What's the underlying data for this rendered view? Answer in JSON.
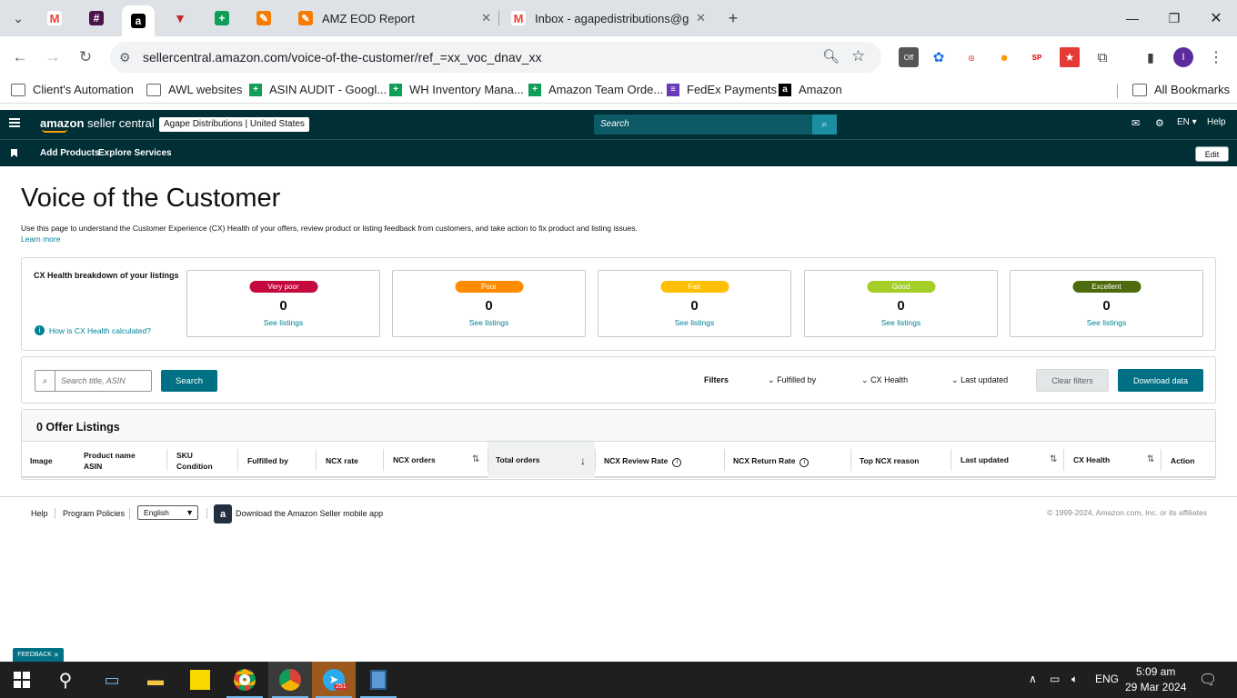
{
  "browser": {
    "tabs": [
      {
        "title": "AMZ EOD Report"
      },
      {
        "title": "Inbox - agapedistributions@gm"
      }
    ],
    "url": "sellercentral.amazon.com/voice-of-the-customer/ref_=xx_voc_dnav_xx",
    "bookmarks": [
      {
        "label": "Client's Automation"
      },
      {
        "label": "AWL websites"
      },
      {
        "label": "ASIN AUDIT - Googl..."
      },
      {
        "label": "WH Inventory Mana..."
      },
      {
        "label": "Amazon Team Orde..."
      },
      {
        "label": "FedEx Payments"
      },
      {
        "label": "Amazon"
      },
      {
        "label": "All Bookmarks"
      }
    ],
    "extension_badge": "Off"
  },
  "header": {
    "logo_brand": "amazon",
    "logo_product": "seller central",
    "account_name": "Agape Distributions",
    "account_region": "United States",
    "search_placeholder": "Search",
    "language": "EN",
    "help": "Help",
    "subnav": [
      "Add Products",
      "Explore Services"
    ],
    "edit_label": "Edit"
  },
  "page": {
    "title": "Voice of the Customer",
    "intro": "Use this page to understand the Customer Experience (CX) Health of your offers, review product or listing feedback from customers, and take action to fix product and listing issues.",
    "learn_more": "Learn more"
  },
  "cx_health": {
    "label": "CX Health breakdown of your listings",
    "how_link": "How is CX Health calculated?",
    "cards": [
      {
        "label": "Very poor",
        "count": "0",
        "link": "See listings",
        "color": "#c40a3d"
      },
      {
        "label": "Poor",
        "count": "0",
        "link": "See listings",
        "color": "#ff8c00"
      },
      {
        "label": "Fair",
        "count": "0",
        "link": "See listings",
        "color": "#ffbf00"
      },
      {
        "label": "Good",
        "count": "0",
        "link": "See listings",
        "color": "#a3cf28"
      },
      {
        "label": "Excellent",
        "count": "0",
        "link": "See listings",
        "color": "#4d6b0d"
      }
    ]
  },
  "search": {
    "placeholder": "Search title, ASIN",
    "button": "Search",
    "filters_label": "Filters",
    "filters": [
      "Fulfilled by",
      "CX Health",
      "Last updated"
    ],
    "clear_button": "Clear filters",
    "download_button": "Download data"
  },
  "table": {
    "count_label": "0 Offer Listings",
    "columns": [
      {
        "line1": "Image",
        "line2": ""
      },
      {
        "line1": "Product name",
        "line2": "ASIN"
      },
      {
        "line1": "SKU",
        "line2": "Condition"
      },
      {
        "line1": "Fulfilled by",
        "line2": ""
      },
      {
        "line1": "NCX rate",
        "line2": ""
      },
      {
        "line1": "NCX orders",
        "line2": ""
      },
      {
        "line1": "Total orders",
        "line2": ""
      },
      {
        "line1": "NCX Review Rate",
        "line2": ""
      },
      {
        "line1": "NCX Return Rate",
        "line2": ""
      },
      {
        "line1": "Top NCX reason",
        "line2": ""
      },
      {
        "line1": "Last updated",
        "line2": ""
      },
      {
        "line1": "CX Health",
        "line2": ""
      },
      {
        "line1": "Action",
        "line2": ""
      }
    ]
  },
  "footer": {
    "links": [
      "Help",
      "Program Policies"
    ],
    "language": "English",
    "app_text": "Download the Amazon Seller mobile app",
    "copyright": "© 1999-2024, Amazon.com, Inc. or its affiliates"
  },
  "feedback": "FEEDBACK",
  "taskbar": {
    "time": "5:09 am",
    "date": "29 Mar 2024",
    "lang": "ENG",
    "telegram_badge": "251"
  },
  "colors": {
    "header": "#002f36",
    "teal": "#007185",
    "link": "#008296"
  }
}
